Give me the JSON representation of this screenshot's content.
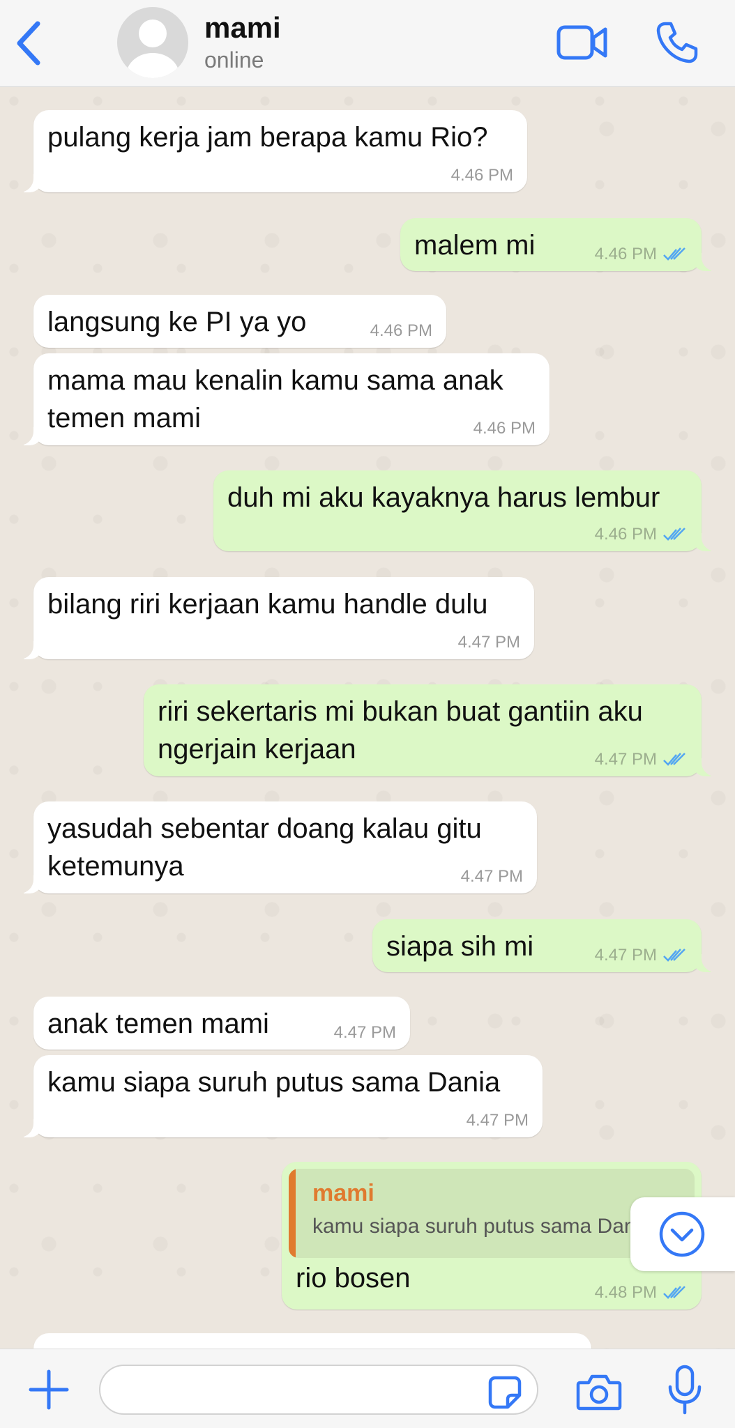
{
  "header": {
    "contact_name": "mami",
    "status": "online"
  },
  "messages": [
    {
      "dir": "in",
      "text": "pulang kerja jam berapa kamu Rio?",
      "time": "4.46 PM"
    },
    {
      "dir": "out",
      "text": "malem mi",
      "time": "4.46 PM",
      "read": true
    },
    {
      "dir": "in",
      "text": "langsung ke PI ya yo",
      "time": "4.46 PM"
    },
    {
      "dir": "in",
      "text": "mama mau kenalin kamu sama anak temen mami",
      "time": "4.46 PM"
    },
    {
      "dir": "out",
      "text": "duh mi aku kayaknya harus lembur",
      "time": "4.46 PM",
      "read": true
    },
    {
      "dir": "in",
      "text": "bilang riri kerjaan kamu handle dulu",
      "time": "4.47 PM"
    },
    {
      "dir": "out",
      "text": "riri sekertaris mi bukan buat gantiin aku ngerjain kerjaan",
      "time": "4.47 PM",
      "read": true
    },
    {
      "dir": "in",
      "text": "yasudah sebentar doang kalau gitu ketemunya",
      "time": "4.47 PM"
    },
    {
      "dir": "out",
      "text": "siapa sih mi",
      "time": "4.47 PM",
      "read": true
    },
    {
      "dir": "in",
      "text": "anak temen mami",
      "time": "4.47 PM"
    },
    {
      "dir": "in",
      "text": "kamu siapa suruh putus sama Dania",
      "time": "4.47 PM"
    },
    {
      "dir": "out",
      "text": "rio bosen",
      "time": "4.48 PM",
      "read": true,
      "quote": {
        "name": "mami",
        "text": "kamu siapa suruh putus sama Dania"
      }
    }
  ],
  "input": {
    "placeholder": "",
    "value": ""
  },
  "icons": {
    "back": "chevron-left-icon",
    "video": "video-camera-icon",
    "call": "phone-icon",
    "plus": "plus-icon",
    "sticker": "sticker-icon",
    "camera": "camera-icon",
    "mic": "microphone-icon",
    "scroll": "chevron-down-circle-icon"
  },
  "colors": {
    "accent": "#3478f6",
    "incoming_bubble": "#ffffff",
    "outgoing_bubble": "#dcf8c6",
    "read_ticks": "#53a6f2",
    "quote_accent": "#e07a2f"
  }
}
